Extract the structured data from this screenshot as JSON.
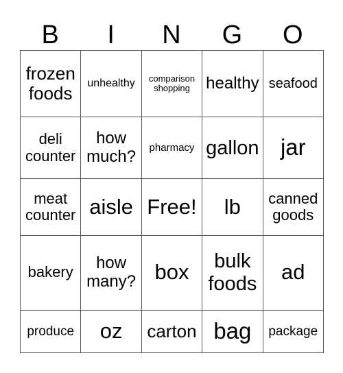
{
  "header": [
    "B",
    "I",
    "N",
    "G",
    "O"
  ],
  "rows": [
    [
      {
        "text": "frozen foods",
        "size": 26
      },
      {
        "text": "unhealthy",
        "size": 16
      },
      {
        "text": "comparison shopping",
        "size": 13
      },
      {
        "text": "healthy",
        "size": 24
      },
      {
        "text": "seafood",
        "size": 20
      }
    ],
    [
      {
        "text": "deli counter",
        "size": 22
      },
      {
        "text": "how much?",
        "size": 24
      },
      {
        "text": "pharmacy",
        "size": 15
      },
      {
        "text": "gallon",
        "size": 29
      },
      {
        "text": "jar",
        "size": 33
      }
    ],
    [
      {
        "text": "meat counter",
        "size": 22
      },
      {
        "text": "aisle",
        "size": 31
      },
      {
        "text": "Free!",
        "size": 31
      },
      {
        "text": "lb",
        "size": 31
      },
      {
        "text": "canned goods",
        "size": 22
      }
    ],
    [
      {
        "text": "bakery",
        "size": 22
      },
      {
        "text": "how many?",
        "size": 24
      },
      {
        "text": "box",
        "size": 31
      },
      {
        "text": "bulk foods",
        "size": 29
      },
      {
        "text": "ad",
        "size": 31
      }
    ],
    [
      {
        "text": "produce",
        "size": 19
      },
      {
        "text": "oz",
        "size": 31
      },
      {
        "text": "carton",
        "size": 26
      },
      {
        "text": "bag",
        "size": 33
      },
      {
        "text": "package",
        "size": 19
      }
    ]
  ]
}
